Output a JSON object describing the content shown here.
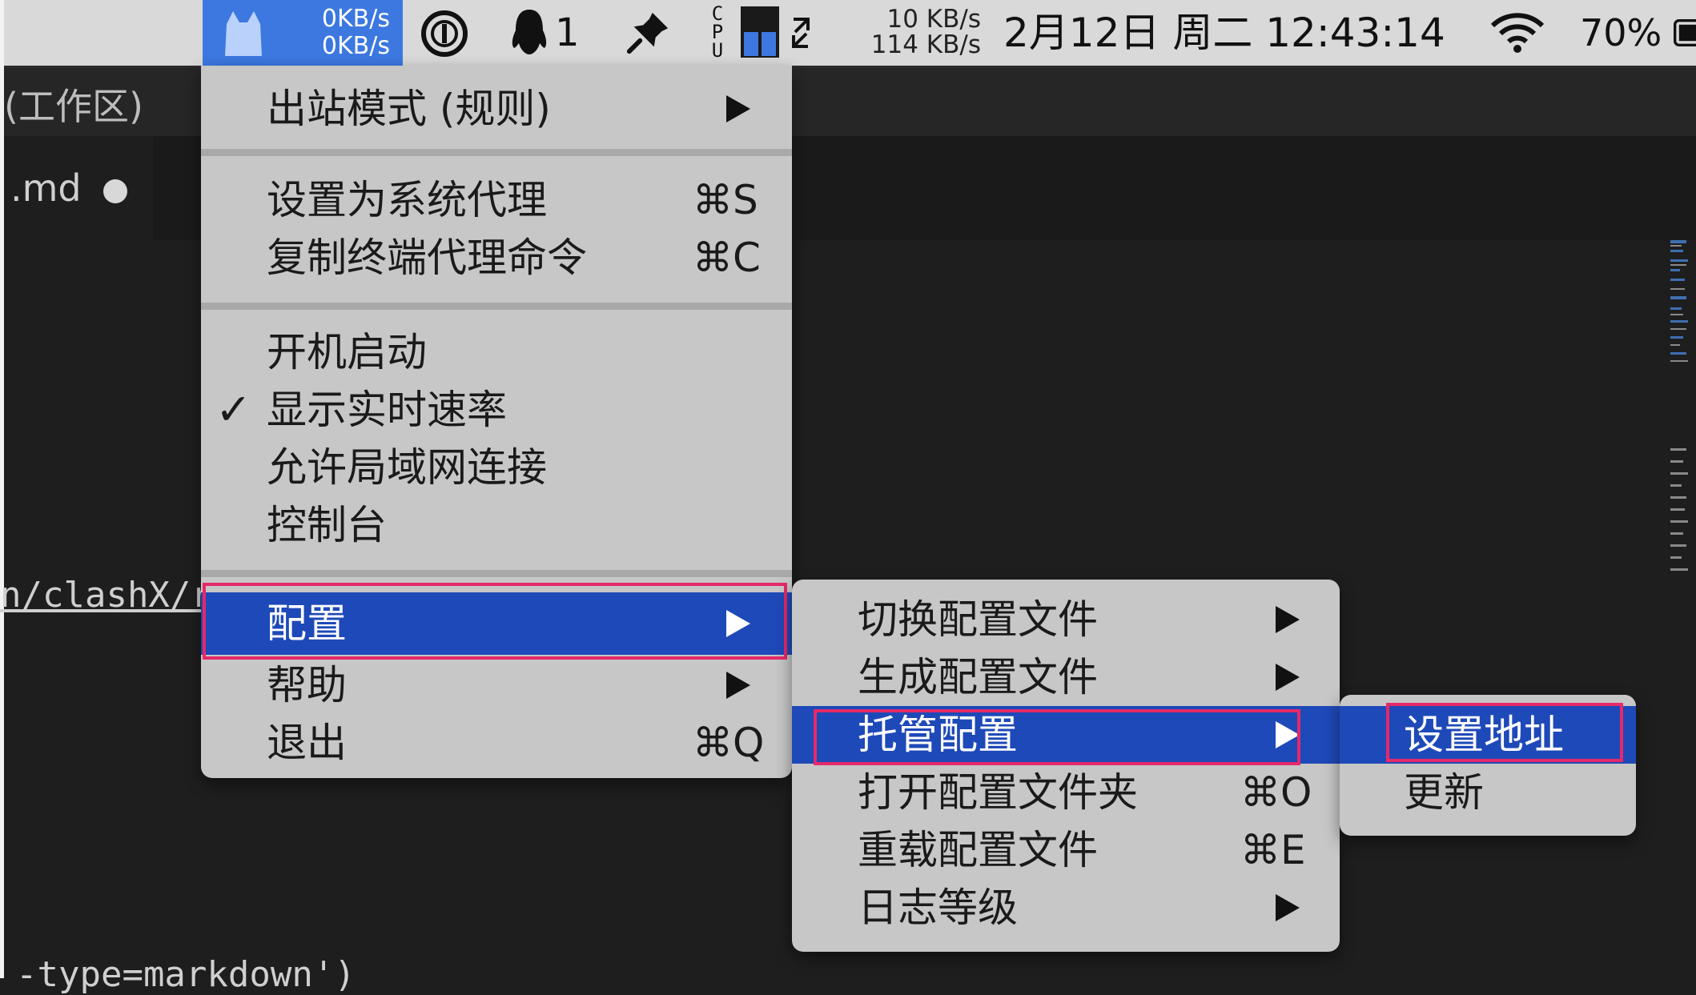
{
  "menubar": {
    "clash_upload": "0KB/s",
    "clash_download": "0KB/s",
    "qq_count": "1",
    "cpu_label": "C P U",
    "net_up": "10 KB/s",
    "net_down": "114 KB/s",
    "datetime": "2月12日 周二 12:43:14",
    "battery": "70%"
  },
  "editor": {
    "workspace_title": "(工作区)",
    "tab_filename": ".md",
    "path_fragment": "n/clashX/r",
    "code_fragment": "-type=markdown')"
  },
  "main_menu": {
    "mode": "出站模式 (规则)",
    "set_system_proxy": "设置为系统代理",
    "set_system_proxy_sc": "⌘S",
    "copy_terminal_cmd": "复制终端代理命令",
    "copy_terminal_cmd_sc": "⌘C",
    "launch_at_login": "开机启动",
    "show_speed": "显示实时速率",
    "show_speed_checked": true,
    "check_mark": "✓",
    "allow_lan": "允许局域网连接",
    "console": "控制台",
    "config": "配置",
    "help": "帮助",
    "quit": "退出",
    "quit_sc": "⌘Q"
  },
  "config_menu": {
    "switch_config": "切换配置文件",
    "generate_config": "生成配置文件",
    "remote_config": "托管配置",
    "open_folder": "打开配置文件夹",
    "open_folder_sc": "⌘O",
    "reload_config": "重载配置文件",
    "reload_config_sc": "⌘E",
    "log_level": "日志等级"
  },
  "remote_menu": {
    "set_url": "设置地址",
    "update": "更新"
  },
  "colors": {
    "menu_bg": "#c7c7c7",
    "selection": "#1e49b8",
    "highlight_box": "#e5296a",
    "clash_accent": "#3c78e0"
  }
}
